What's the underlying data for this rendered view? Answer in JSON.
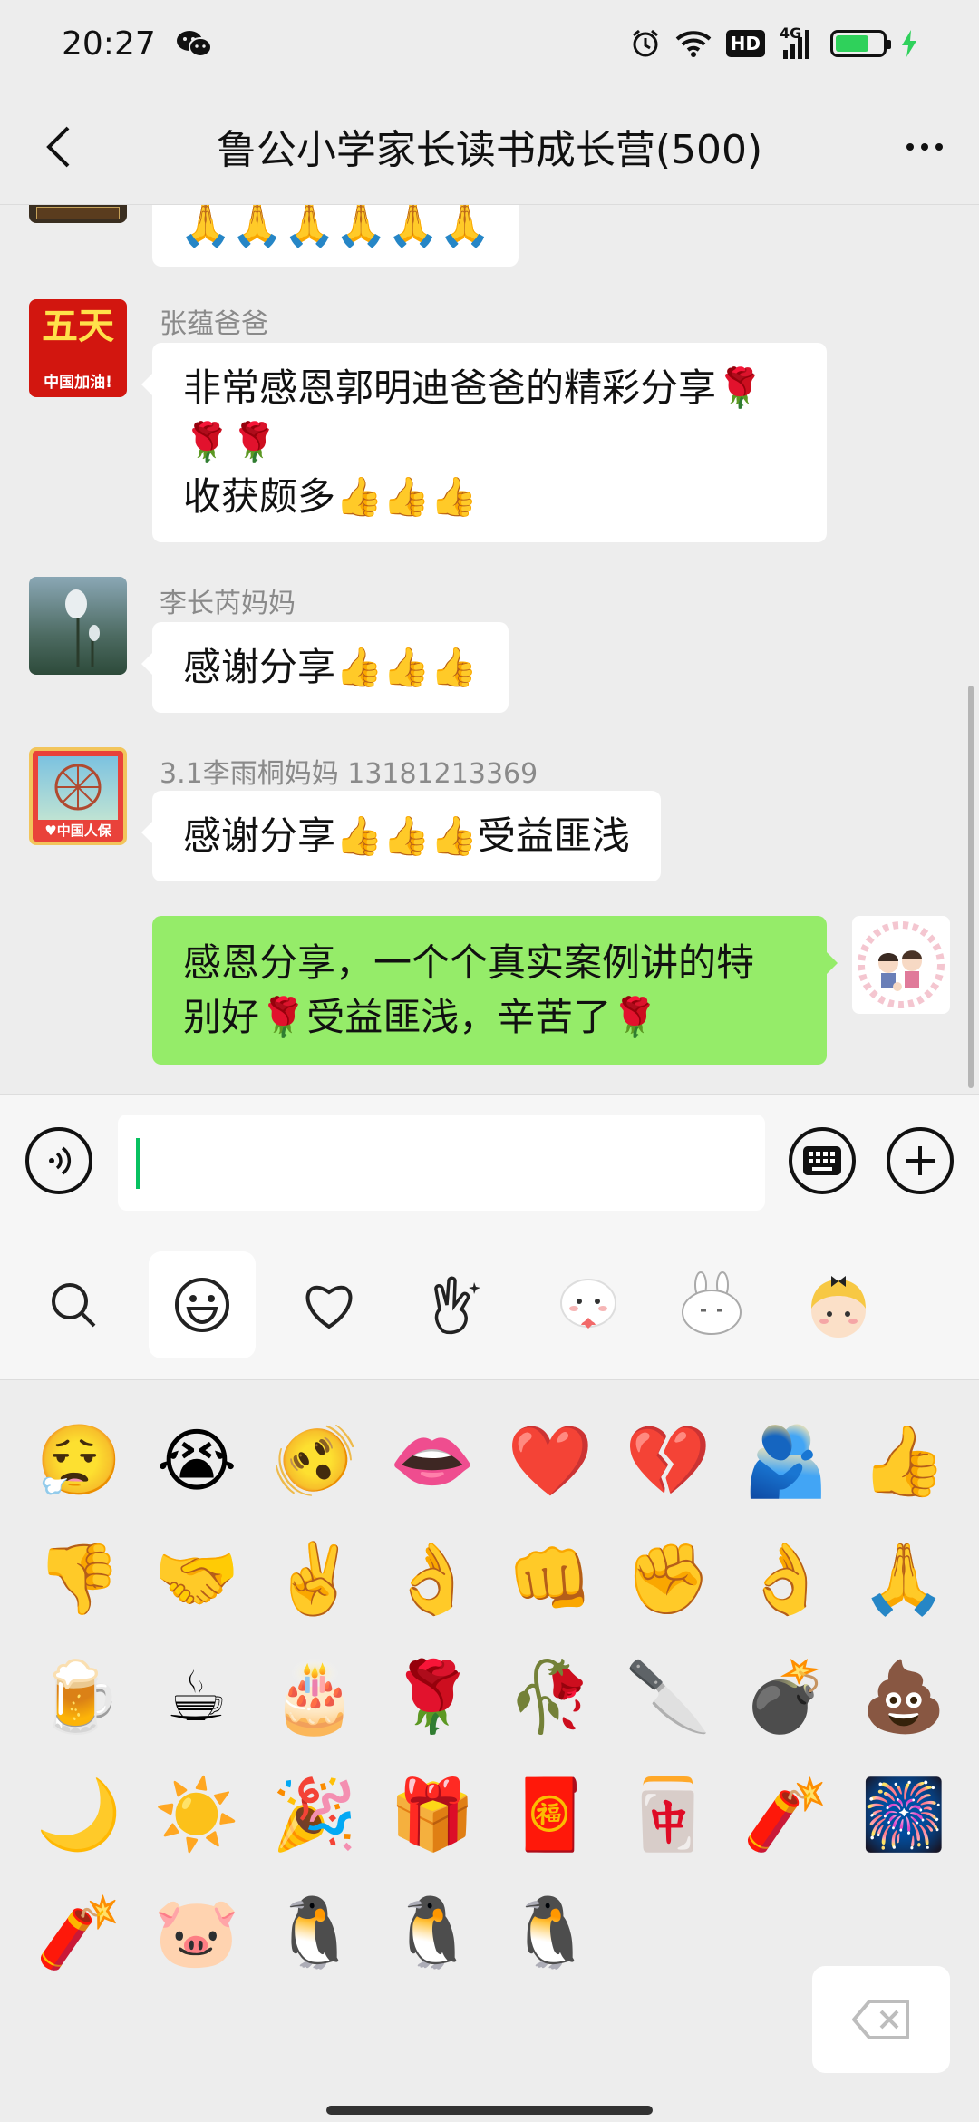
{
  "status_bar": {
    "time": "20:27",
    "icons": [
      "wechat-icon",
      "alarm-icon",
      "wifi-icon",
      "hd-icon",
      "signal-4g-icon",
      "battery-icon",
      "charging-icon"
    ],
    "hd_label": "HD",
    "network_label": "4G",
    "battery_level": 0.72
  },
  "header": {
    "title": "鲁公小学家长读书成长营(500)"
  },
  "chat": {
    "partial_message": {
      "text": "🙏🙏🙏🙏🙏🙏"
    },
    "messages": [
      {
        "sender": "张蕴爸爸",
        "lines": [
          "非常感恩郭明迪爸爸的精彩分享🌹",
          "🌹🌹",
          "收获颇多👍👍👍"
        ]
      },
      {
        "sender": "李长芮妈妈",
        "lines": [
          "感谢分享👍👍👍"
        ]
      },
      {
        "sender": "3.1李雨桐妈妈 13181213369",
        "lines": [
          "感谢分享👍👍👍受益匪浅"
        ]
      },
      {
        "sender": "",
        "mine": true,
        "lines": [
          "感恩分享，一个个真实案例讲的特",
          "别好🌹受益匪浅，辛苦了🌹"
        ]
      }
    ]
  },
  "input_bar": {
    "voice_icon": "voice-icon",
    "keyboard_icon": "keyboard-icon",
    "plus_icon": "plus-icon",
    "value": ""
  },
  "emoji_tabs": [
    "search-icon",
    "smiley-icon",
    "heart-icon",
    "gesture-icon",
    "sticker-bear-icon",
    "sticker-bunny-icon",
    "sticker-girl-icon"
  ],
  "emoji_grid": {
    "rows": [
      [
        "😮‍💨",
        "😭",
        "🫨",
        "👄",
        "❤️",
        "💔",
        "🫂",
        "👍"
      ],
      [
        "👎",
        "🤝",
        "✌️",
        "👌",
        "👊",
        "✊",
        "👌",
        "🙏"
      ],
      [
        "🍺",
        "☕",
        "🎂",
        "🌹",
        "🥀",
        "🔪",
        "💣",
        "💩"
      ],
      [
        "🌙",
        "☀️",
        "🎉",
        "🎁",
        "🧧",
        "🀄",
        "🧨",
        "🎆"
      ],
      [
        "🧨",
        "🐷",
        "🐧",
        "🐧",
        "🐧"
      ]
    ]
  },
  "colors": {
    "background": "#ededed",
    "my_bubble": "#95ec69",
    "accent": "#07c160"
  }
}
